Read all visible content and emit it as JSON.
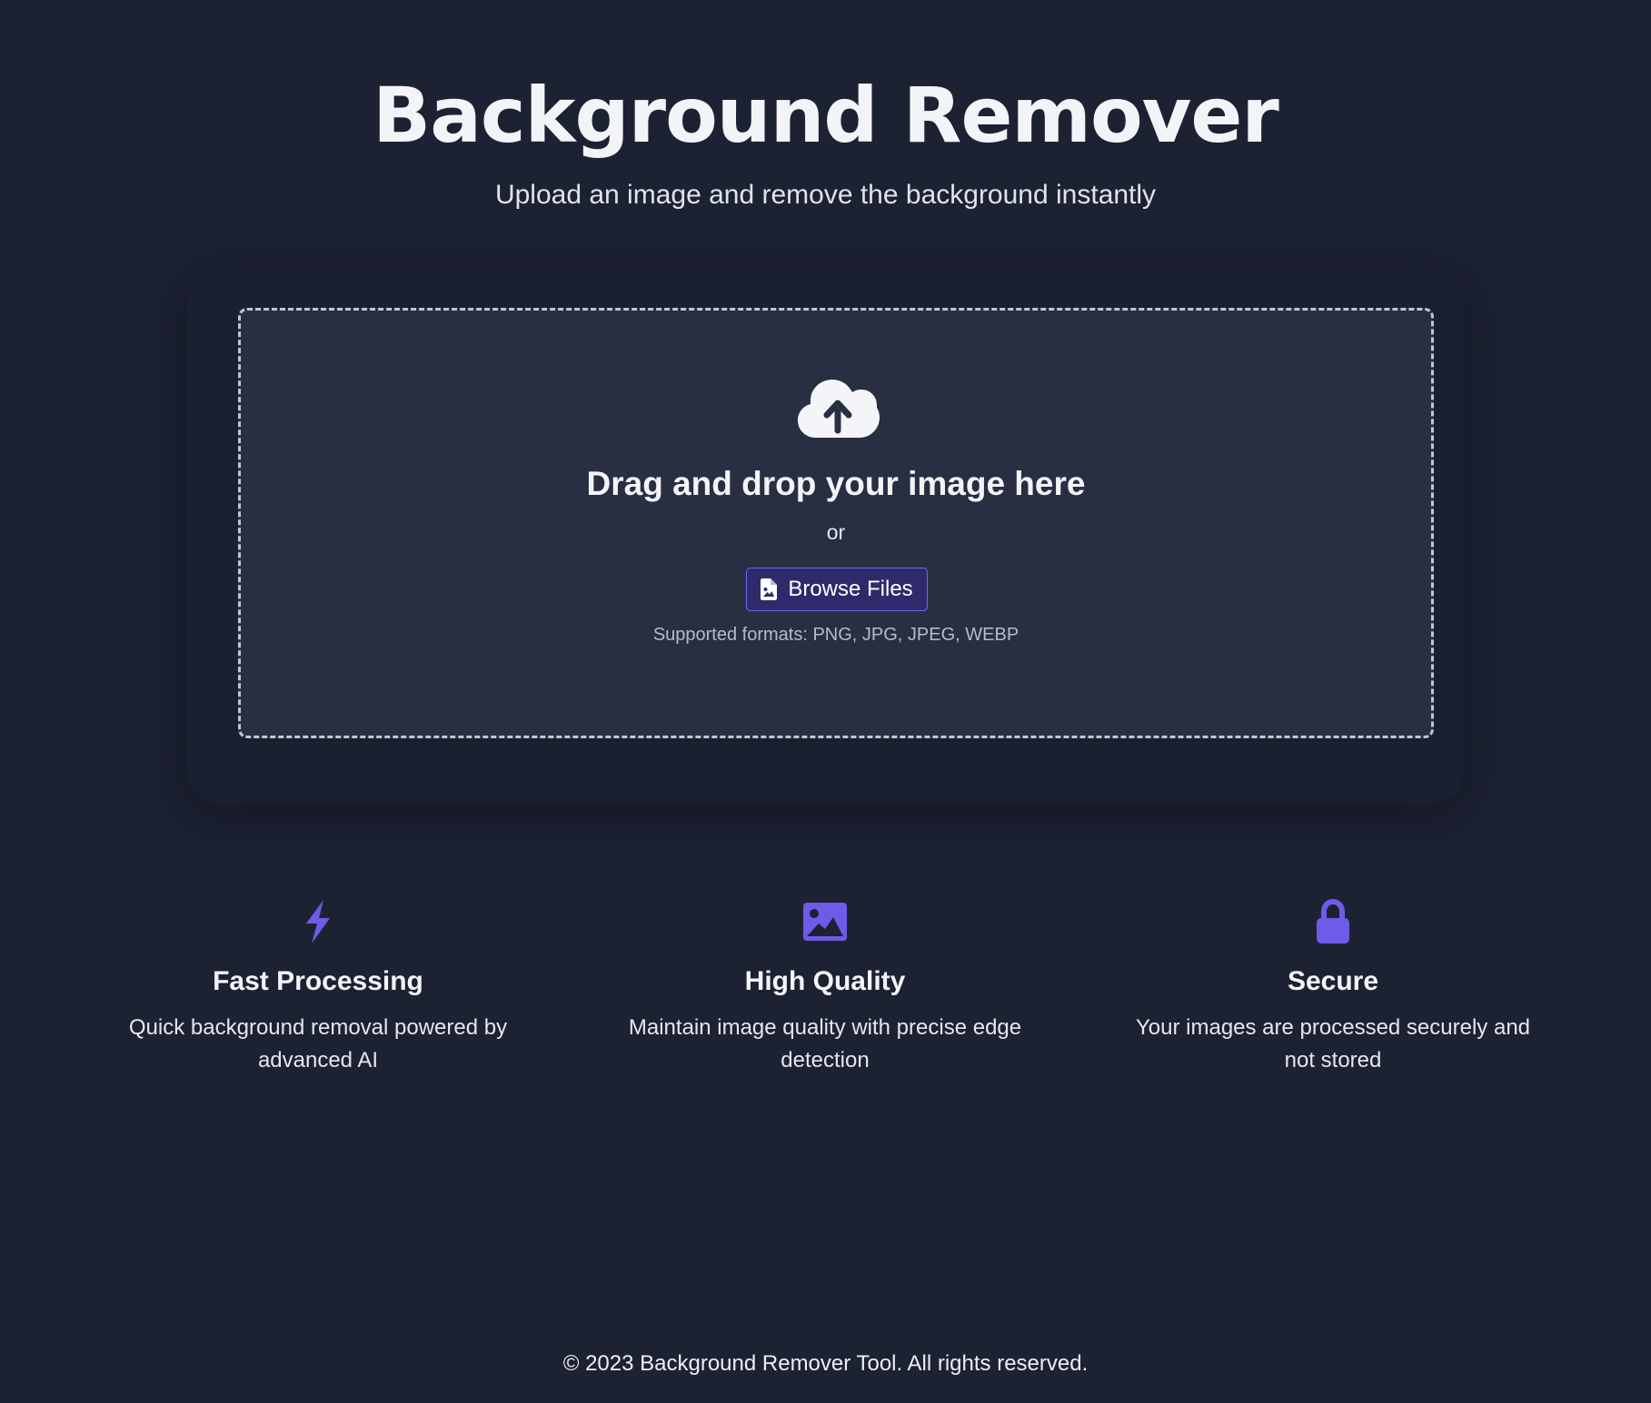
{
  "header": {
    "title": "Background Remover",
    "subtitle": "Upload an image and remove the background instantly"
  },
  "upload": {
    "icon": "cloud-upload-icon",
    "heading": "Drag and drop your image here",
    "or": "or",
    "browse_label": "Browse Files",
    "browse_icon": "file-image-icon",
    "formats": "Supported formats: PNG, JPG, JPEG, WEBP"
  },
  "features": [
    {
      "icon": "bolt-icon",
      "title": "Fast Processing",
      "description": "Quick background removal powered by advanced AI"
    },
    {
      "icon": "image-icon",
      "title": "High Quality",
      "description": "Maintain image quality with precise edge detection"
    },
    {
      "icon": "lock-icon",
      "title": "Secure",
      "description": "Your images are processed securely and not stored"
    }
  ],
  "footer": {
    "text": "© 2023 Background Remover Tool. All rights reserved."
  },
  "colors": {
    "background": "#1d2233",
    "dropzone": "#292f42",
    "accent": "#6c5ce7",
    "button_bg": "#2e2a6b"
  }
}
